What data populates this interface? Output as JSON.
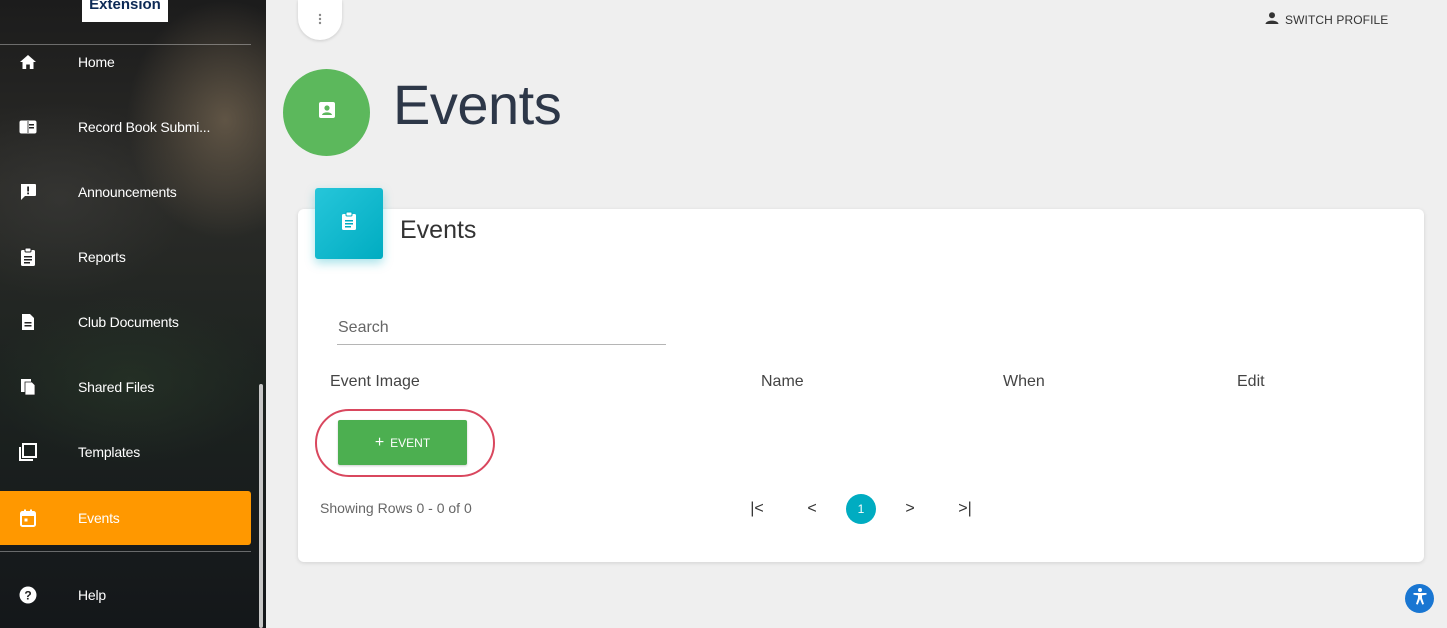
{
  "sidebar": {
    "logo_text": "Extension",
    "items": [
      {
        "label": "Home",
        "icon": "home-icon"
      },
      {
        "label": "Record Book Submi...",
        "icon": "book-icon"
      },
      {
        "label": "Announcements",
        "icon": "announcement-icon"
      },
      {
        "label": "Reports",
        "icon": "clipboard-icon"
      },
      {
        "label": "Club Documents",
        "icon": "document-icon"
      },
      {
        "label": "Shared Files",
        "icon": "files-icon"
      },
      {
        "label": "Templates",
        "icon": "template-icon"
      },
      {
        "label": "Events",
        "icon": "calendar-icon",
        "active": true
      },
      {
        "label": "Help",
        "icon": "help-icon"
      }
    ],
    "active_color": "#ff9800"
  },
  "header": {
    "menu_icon": "more-vert-icon",
    "switch_profile_label": "SWITCH PROFILE",
    "page_title": "Events",
    "page_icon": "contact-card-icon",
    "page_icon_color": "#5cb85c"
  },
  "card": {
    "title": "Events",
    "icon": "clipboard-icon",
    "icon_color": "#00acc1",
    "search_placeholder": "Search",
    "columns": [
      "Event Image",
      "Name",
      "When",
      "Edit"
    ],
    "add_button_label": "EVENT",
    "add_button_color": "#4caf50",
    "highlight_color": "#d9475e",
    "rows_info": "Showing Rows 0 - 0 of 0",
    "pagination": {
      "first": "|<",
      "prev": "<",
      "current_page": "1",
      "next": ">",
      "last": ">|"
    }
  },
  "accessibility_icon": "accessibility-icon"
}
